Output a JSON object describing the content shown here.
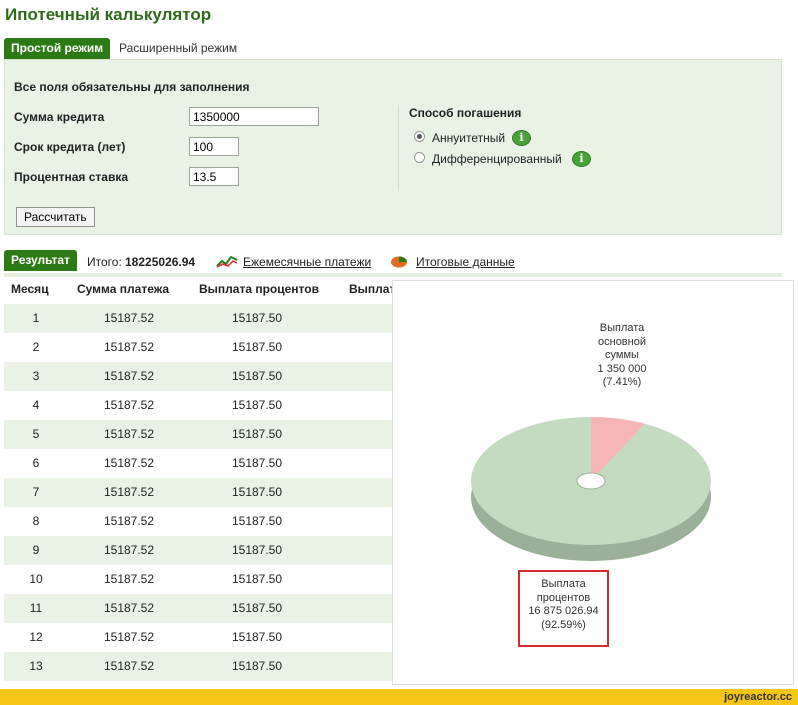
{
  "app": {
    "title": "Ипотечный калькулятор"
  },
  "tabs": [
    {
      "label": "Простой режим",
      "active": true
    },
    {
      "label": "Расширенный режим",
      "active": false
    }
  ],
  "form": {
    "required_note": "Все поля обязательны для заполнения",
    "amount_label": "Сумма кредита",
    "amount_value": "1350000",
    "term_label": "Срок кредита (лет)",
    "term_value": "100",
    "rate_label": "Процентная ставка",
    "rate_value": "13.5",
    "method_title": "Способ погашения",
    "options": [
      {
        "label": "Аннуитетный",
        "selected": true
      },
      {
        "label": "Дифференцированный",
        "selected": false
      }
    ],
    "calc_button": "Рассчитать"
  },
  "results": {
    "tab_label": "Результат",
    "total_label": "Итого:",
    "total_value": "18225026.94",
    "monthly_link": "Ежемесячные платежи",
    "summary_link": "Итоговые данные",
    "columns": [
      "Месяц",
      "Сумма платежа",
      "Выплата процентов",
      "Выплат"
    ],
    "rows": [
      {
        "month": "1",
        "payment": "15187.52",
        "interest": "15187.50"
      },
      {
        "month": "2",
        "payment": "15187.52",
        "interest": "15187.50"
      },
      {
        "month": "3",
        "payment": "15187.52",
        "interest": "15187.50"
      },
      {
        "month": "4",
        "payment": "15187.52",
        "interest": "15187.50"
      },
      {
        "month": "5",
        "payment": "15187.52",
        "interest": "15187.50"
      },
      {
        "month": "6",
        "payment": "15187.52",
        "interest": "15187.50"
      },
      {
        "month": "7",
        "payment": "15187.52",
        "interest": "15187.50"
      },
      {
        "month": "8",
        "payment": "15187.52",
        "interest": "15187.50"
      },
      {
        "month": "9",
        "payment": "15187.52",
        "interest": "15187.50"
      },
      {
        "month": "10",
        "payment": "15187.52",
        "interest": "15187.50"
      },
      {
        "month": "11",
        "payment": "15187.52",
        "interest": "15187.50"
      },
      {
        "month": "12",
        "payment": "15187.52",
        "interest": "15187.50"
      },
      {
        "month": "13",
        "payment": "15187.52",
        "interest": "15187.50"
      }
    ]
  },
  "chart_data": {
    "type": "pie",
    "slices": [
      {
        "name": "Выплата основной суммы",
        "value": 1350000,
        "label_value": "1 350 000",
        "percent": "(7.41%)",
        "color": "#f7b6b6"
      },
      {
        "name": "Выплата процентов",
        "value": 16875026.94,
        "label_value": "16 875 026.94",
        "percent": "(92.59%)",
        "color": "#c3dcc0"
      }
    ]
  },
  "labels": {
    "principal": [
      "Выплата",
      "основной",
      "суммы"
    ],
    "interest": [
      "Выплата",
      "процентов"
    ]
  },
  "colors": {
    "accent": "#2c7a15",
    "row_alt": "#e9f2e5",
    "highlight": "#d22c2c",
    "footer": "#f5c518"
  },
  "footer": {
    "brand": "joyreactor.cc"
  }
}
